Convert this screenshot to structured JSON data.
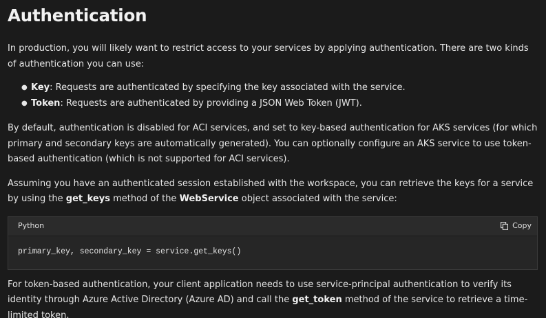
{
  "heading": "Authentication",
  "intro": "In production, you will likely want to restrict access to your services by applying authentication. There are two kinds of authentication you can use:",
  "bullets": [
    {
      "term": "Key",
      "text": ": Requests are authenticated by specifying the key associated with the service."
    },
    {
      "term": "Token",
      "text": ": Requests are authenticated by providing a JSON Web Token (JWT)."
    }
  ],
  "para_default": "By default, authentication is disabled for ACI services, and set to key-based authentication for AKS services (for which primary and secondary keys are automatically generated). You can optionally configure an AKS service to use token-based authentication (which is not supported for ACI services).",
  "para_keys": {
    "before": "Assuming you have an authenticated session established with the workspace, you can retrieve the keys for a service by using the ",
    "method": "get_keys",
    "middle": " method of the ",
    "object": "WebService",
    "after": " object associated with the service:"
  },
  "code": {
    "language": "Python",
    "copy_label": "Copy",
    "line": "primary_key, secondary_key = service.get_keys()"
  },
  "para_token": {
    "before": "For token-based authentication, your client application needs to use service-principal authentication to verify its identity through Azure Active Directory (Azure AD) and call the ",
    "method": "get_token",
    "after": " method of the service to retrieve a time-limited token."
  }
}
